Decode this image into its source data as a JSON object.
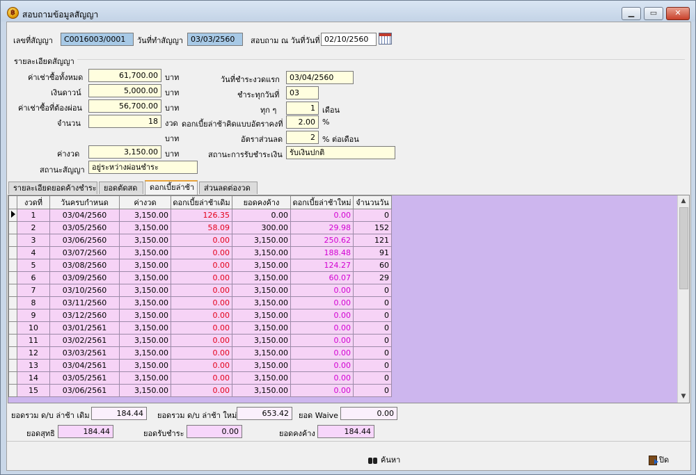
{
  "window": {
    "title": "สอบถามข้อมูลสัญญา",
    "min_label": "▁",
    "max_label": "▭",
    "close_label": "✕",
    "app_icon_glyph": "฿"
  },
  "header": {
    "contract_no_label": "เลขที่สัญญา",
    "contract_no": "C0016003/0001",
    "contract_date_label": "วันที่ทำสัญญา",
    "contract_date": "03/03/2560",
    "query_date_label": "สอบถาม ณ วันที่วันที่",
    "query_date": "02/10/2560"
  },
  "details": {
    "group_label": "รายละเอียดสัญญา",
    "total_rent_label": "ค่าเช่าซื้อทั้งหมด",
    "total_rent": "61,700.00",
    "down_label": "เงินดาวน์",
    "down": "5,000.00",
    "installment_rent_label": "ค่าเช่าซื้อที่ต้องผ่อน",
    "installment_rent": "56,700.00",
    "count_label": "จำนวน",
    "count": "18",
    "count_unit": "งวด",
    "baht": "บาท",
    "per_period_label": "ค่างวด",
    "per_period": "3,150.00",
    "status_label": "สถานะสัญญา",
    "status": "อยู่ระหว่างผ่อนชำระ",
    "first_due_label": "วันที่ชำระงวดแรก",
    "first_due": "03/04/2560",
    "pay_day_label": "ชำระทุกวันที่",
    "pay_day": "03",
    "every_label": "ทุก ๆ",
    "every": "1",
    "every_unit": "เดือน",
    "late_rate_label": "ดอกเบี้ยล่าช้าคิดแบบอัตราคงที่",
    "late_rate": "2.00",
    "late_rate_unit": "%",
    "discount_label": "อัตราส่วนลด",
    "discount": "2",
    "discount_unit": "% ต่อเดือน",
    "receive_status_label": "สถานะการรับชำระเงิน",
    "receive_status": "รับเงินปกติ"
  },
  "tabs": [
    "รายละเอียดยอดค้างชำระ",
    "ยอดตัดสด",
    "ดอกเบี้ยล่าช้า",
    "ส่วนลดต่องวด"
  ],
  "grid": {
    "columns": [
      "งวดที่",
      "วันครบกำหนด",
      "ค่างวด",
      "ดอกเบี้ยล่าช้าเดิม",
      "ยอดคงค้าง",
      "ดอกเบี้ยล่าช้าใหม่",
      "จำนวนวัน"
    ],
    "rows": [
      [
        "1",
        "03/04/2560",
        "3,150.00",
        "126.35",
        "0.00",
        "0.00",
        "0"
      ],
      [
        "2",
        "03/05/2560",
        "3,150.00",
        "58.09",
        "300.00",
        "29.98",
        "152"
      ],
      [
        "3",
        "03/06/2560",
        "3,150.00",
        "0.00",
        "3,150.00",
        "250.62",
        "121"
      ],
      [
        "4",
        "03/07/2560",
        "3,150.00",
        "0.00",
        "3,150.00",
        "188.48",
        "91"
      ],
      [
        "5",
        "03/08/2560",
        "3,150.00",
        "0.00",
        "3,150.00",
        "124.27",
        "60"
      ],
      [
        "6",
        "03/09/2560",
        "3,150.00",
        "0.00",
        "3,150.00",
        "60.07",
        "29"
      ],
      [
        "7",
        "03/10/2560",
        "3,150.00",
        "0.00",
        "3,150.00",
        "0.00",
        "0"
      ],
      [
        "8",
        "03/11/2560",
        "3,150.00",
        "0.00",
        "3,150.00",
        "0.00",
        "0"
      ],
      [
        "9",
        "03/12/2560",
        "3,150.00",
        "0.00",
        "3,150.00",
        "0.00",
        "0"
      ],
      [
        "10",
        "03/01/2561",
        "3,150.00",
        "0.00",
        "3,150.00",
        "0.00",
        "0"
      ],
      [
        "11",
        "03/02/2561",
        "3,150.00",
        "0.00",
        "3,150.00",
        "0.00",
        "0"
      ],
      [
        "12",
        "03/03/2561",
        "3,150.00",
        "0.00",
        "3,150.00",
        "0.00",
        "0"
      ],
      [
        "13",
        "03/04/2561",
        "3,150.00",
        "0.00",
        "3,150.00",
        "0.00",
        "0"
      ],
      [
        "14",
        "03/05/2561",
        "3,150.00",
        "0.00",
        "3,150.00",
        "0.00",
        "0"
      ],
      [
        "15",
        "03/06/2561",
        "3,150.00",
        "0.00",
        "3,150.00",
        "0.00",
        "0"
      ]
    ]
  },
  "totals": {
    "old_late_label": "ยอดรวม ด/บ ล่าช้า เดิม",
    "old_late": "184.44",
    "new_late_label": "ยอดรวม ด/บ ล่าช้า ใหม่",
    "new_late": "653.42",
    "waive_label": "ยอด Waive",
    "waive": "0.00",
    "net_label": "ยอดสุทธิ",
    "net": "184.44",
    "received_label": "ยอดรับชำระ",
    "received": "0.00",
    "outstanding_label": "ยอดคงค้าง",
    "outstanding": "184.44"
  },
  "buttons": {
    "search": "ค้นหา",
    "close": "ปิด"
  }
}
